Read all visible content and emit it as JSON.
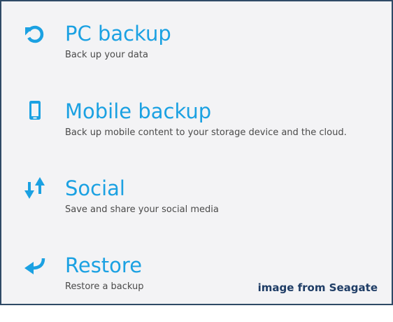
{
  "items": [
    {
      "title": "PC backup",
      "description": "Back up your data",
      "icon": "refresh-icon"
    },
    {
      "title": "Mobile backup",
      "description": "Back up mobile content to your storage device and the cloud.",
      "icon": "mobile-phone-icon"
    },
    {
      "title": "Social",
      "description": "Save and share your social media",
      "icon": "up-down-arrows-icon"
    },
    {
      "title": "Restore",
      "description": "Restore a backup",
      "icon": "return-arrow-icon"
    }
  ],
  "watermark": "image from Seagate",
  "colors": {
    "accent": "#1ba1e2",
    "description_text": "#4a4a4a",
    "background": "#f3f3f5",
    "border": "#2f4a66",
    "watermark": "#1f3d66"
  }
}
